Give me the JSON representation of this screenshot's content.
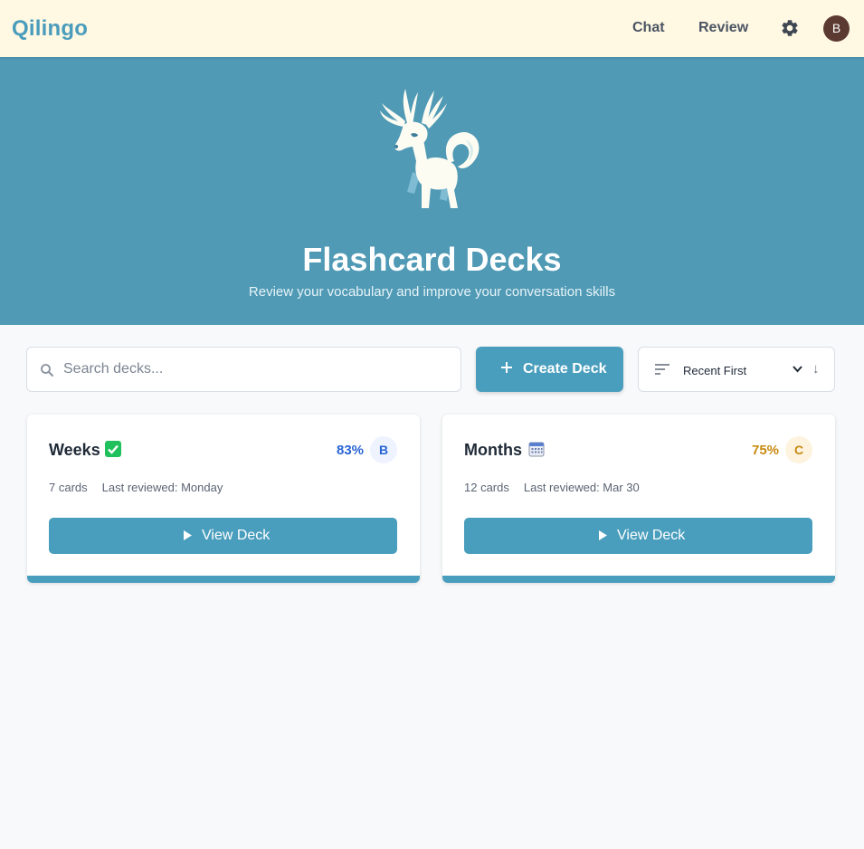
{
  "app": {
    "name": "Qilingo"
  },
  "nav": {
    "chat": "Chat",
    "review": "Review",
    "avatar_initial": "B"
  },
  "hero": {
    "title": "Flashcard Decks",
    "subtitle": "Review your vocabulary and improve your conversation skills"
  },
  "toolbar": {
    "search_placeholder": "Search decks...",
    "create_label": "Create Deck",
    "sort_label": "Recent First",
    "sort_direction": "↓"
  },
  "decks": [
    {
      "title": "Weeks",
      "icon": "check-mark-icon",
      "percent": "83%",
      "grade": "B",
      "cards": "7 cards",
      "last_reviewed": "Last reviewed: Monday",
      "button": "View Deck",
      "accent": "#2864d4"
    },
    {
      "title": "Months",
      "icon": "calendar-icon",
      "percent": "75%",
      "grade": "C",
      "cards": "12 cards",
      "last_reviewed": "Last reviewed: Mar 30",
      "button": "View Deck",
      "accent": "#c78a12"
    }
  ],
  "colors": {
    "brand": "#4a9ebd",
    "hero_bg": "#509ab5",
    "topbar_bg": "#fff8e3"
  }
}
